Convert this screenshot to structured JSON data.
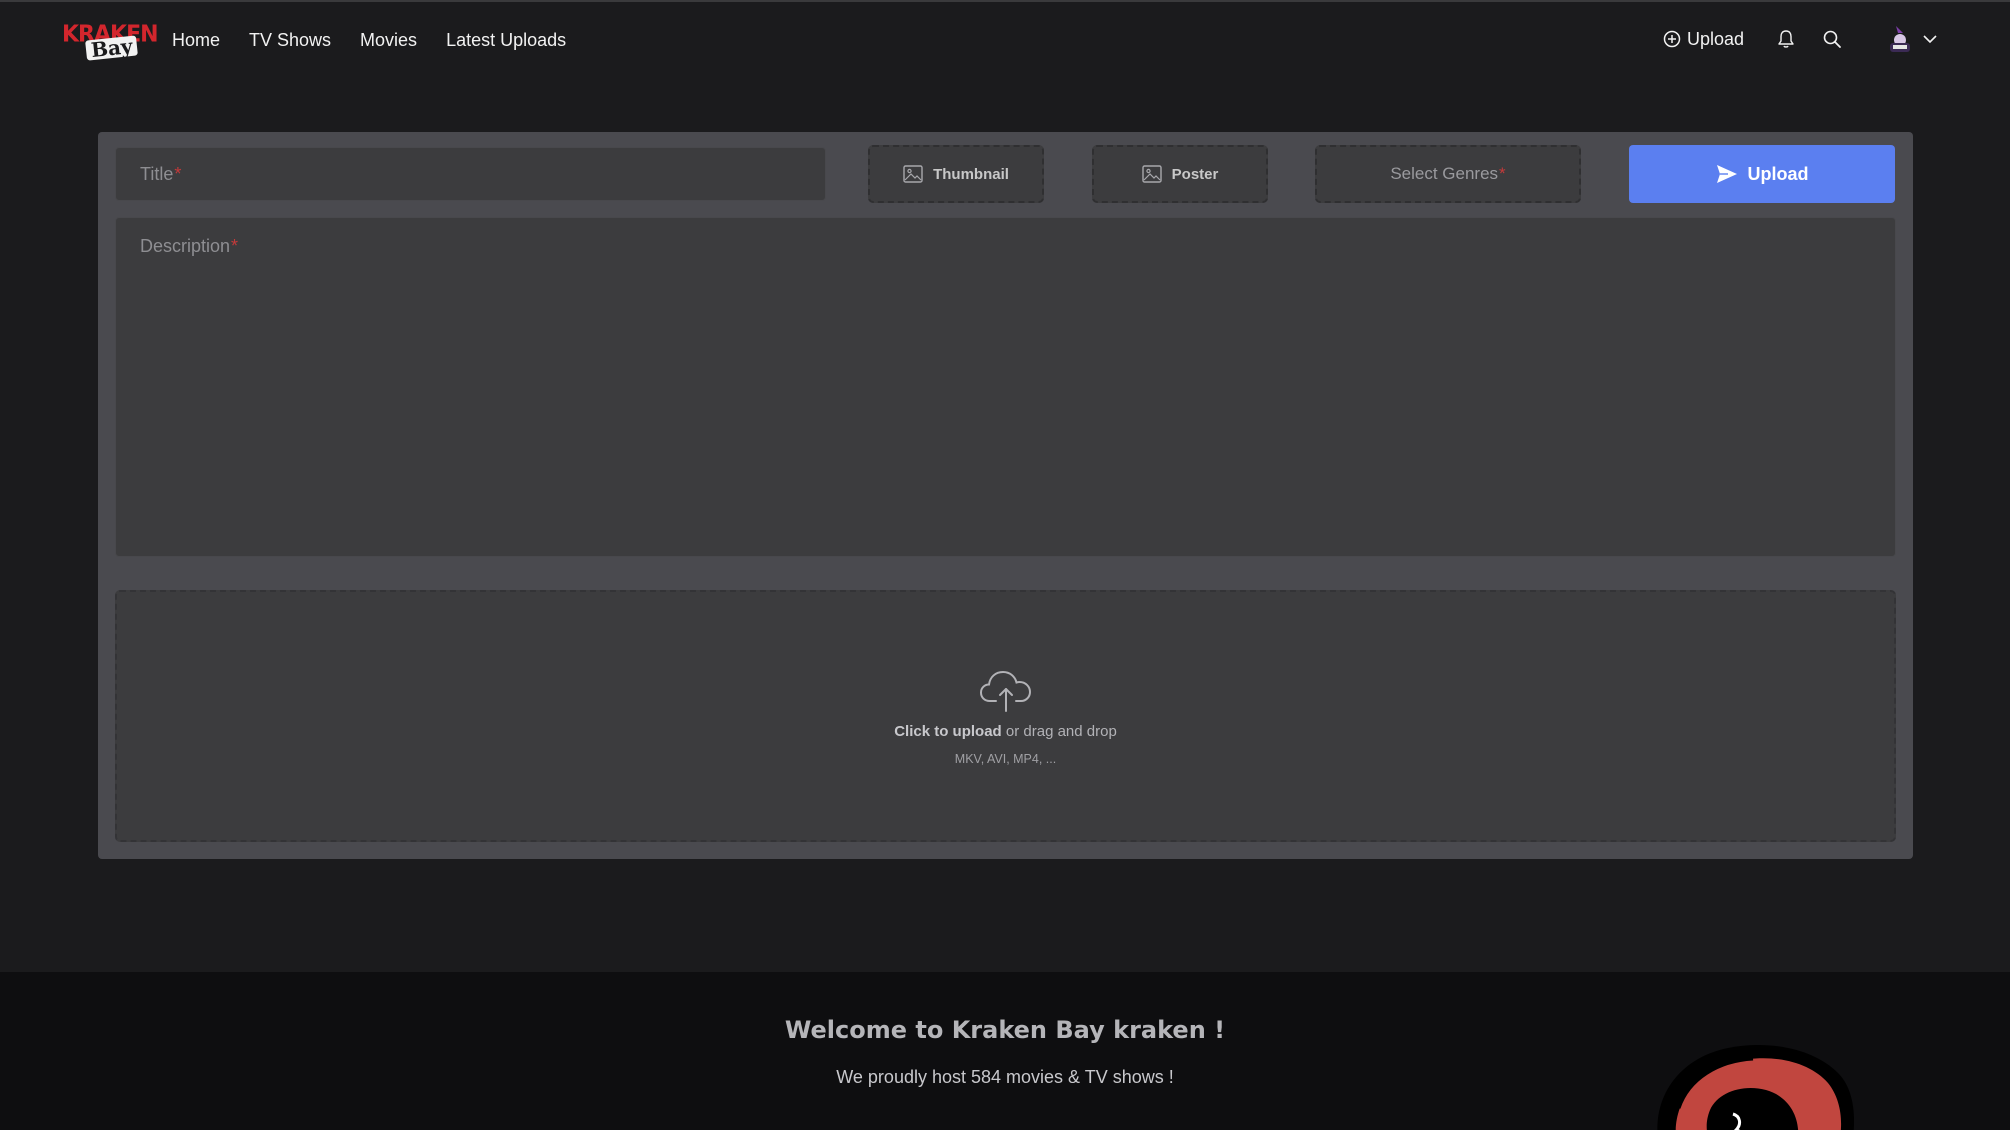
{
  "brand": {
    "logo_top": "KRAKEN",
    "logo_bottom": "Bay"
  },
  "nav": {
    "links": [
      "Home",
      "TV Shows",
      "Movies",
      "Latest Uploads"
    ],
    "upload_label": "Upload"
  },
  "form": {
    "title_placeholder": "Title",
    "required_mark": "*",
    "thumbnail_label": "Thumbnail",
    "poster_label": "Poster",
    "genres_placeholder": "Select Genres",
    "submit_label": "Upload",
    "description_placeholder": "Description"
  },
  "dropzone": {
    "click_text": "Click to upload",
    "rest_text": " or drag and drop",
    "formats": "MKV, AVI, MP4, ..."
  },
  "footer": {
    "welcome": "Welcome to Kraken Bay kraken !",
    "host_text": "We proudly host 584 movies & TV shows !"
  },
  "colors": {
    "background": "#1b1b1d",
    "card": "#4a4a4f",
    "accent": "#5b7ff0",
    "brand_red": "#d3262d",
    "footer": "#0e0e10"
  }
}
